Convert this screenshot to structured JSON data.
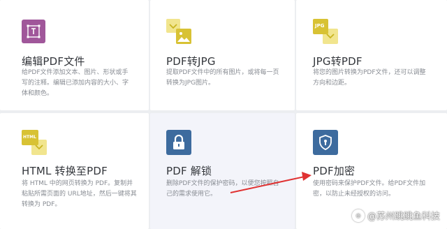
{
  "cards": [
    {
      "title": "编辑PDF文件",
      "desc": "给PDF文件添加文本、图片、形状或手写的注释。编辑已添加内容的大小、字体和颜色。",
      "icon": "edit-pdf-icon",
      "color": "#a0579a"
    },
    {
      "title": "PDF转JPG",
      "desc": "提取PDF文件中的所有图片，或将每一页转换为JPG图片。",
      "icon": "pdf-to-jpg-icon",
      "color": "#d8c234"
    },
    {
      "title": "JPG转PDF",
      "desc": "将您的图片转换为PDF文件，还可以调整方向和边距。",
      "icon": "jpg-to-pdf-icon",
      "color": "#d8c234",
      "badge": "JPG"
    },
    {
      "title": "HTML 转换至PDF",
      "desc": "将 HTML 中的网页转换为 PDF。复制并粘贴所需页面的 URL地址，然后一键将其转换为 PDF。",
      "icon": "html-to-pdf-icon",
      "color": "#d8c234",
      "badge": "HTML"
    },
    {
      "title": "PDF 解锁",
      "desc": "删除PDF文件的保护密码，以便您按照自己的需求使用它。",
      "icon": "unlock-pdf-icon",
      "color": "#3d6b9e"
    },
    {
      "title": "PDF加密",
      "desc": "使用密码来保护PDF文件。给PDF文件加密，以防止未经授权的访问。",
      "icon": "protect-pdf-icon",
      "color": "#3d6b9e"
    }
  ],
  "watermark": "@苏州跳跳鱼科技",
  "annotation_color": "#e03232"
}
